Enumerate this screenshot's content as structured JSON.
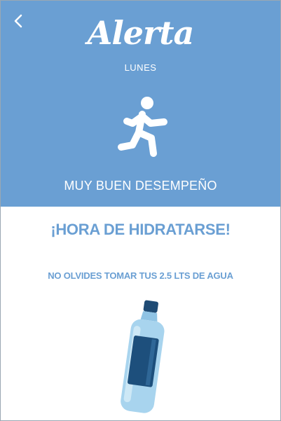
{
  "header": {
    "brand_title": "Alerta",
    "day_label": "LUNES",
    "status_text": "MUY BUEN DESEMPEÑO",
    "back_icon": "chevron-left-icon",
    "activity_icon": "running-person-icon"
  },
  "content": {
    "headline": "¡HORA DE HIDRATARSE!",
    "reminder_text": "NO OLVIDES TOMAR TUS 2.5 LTS DE AGUA",
    "illustration": "water-bottle-icon"
  },
  "colors": {
    "header_background": "#6a9fd3",
    "accent_text": "#6a9fd3",
    "bottle_body": "#a8d4ee",
    "bottle_label": "#1d4f7c",
    "bottle_cap": "#1f4b74"
  }
}
